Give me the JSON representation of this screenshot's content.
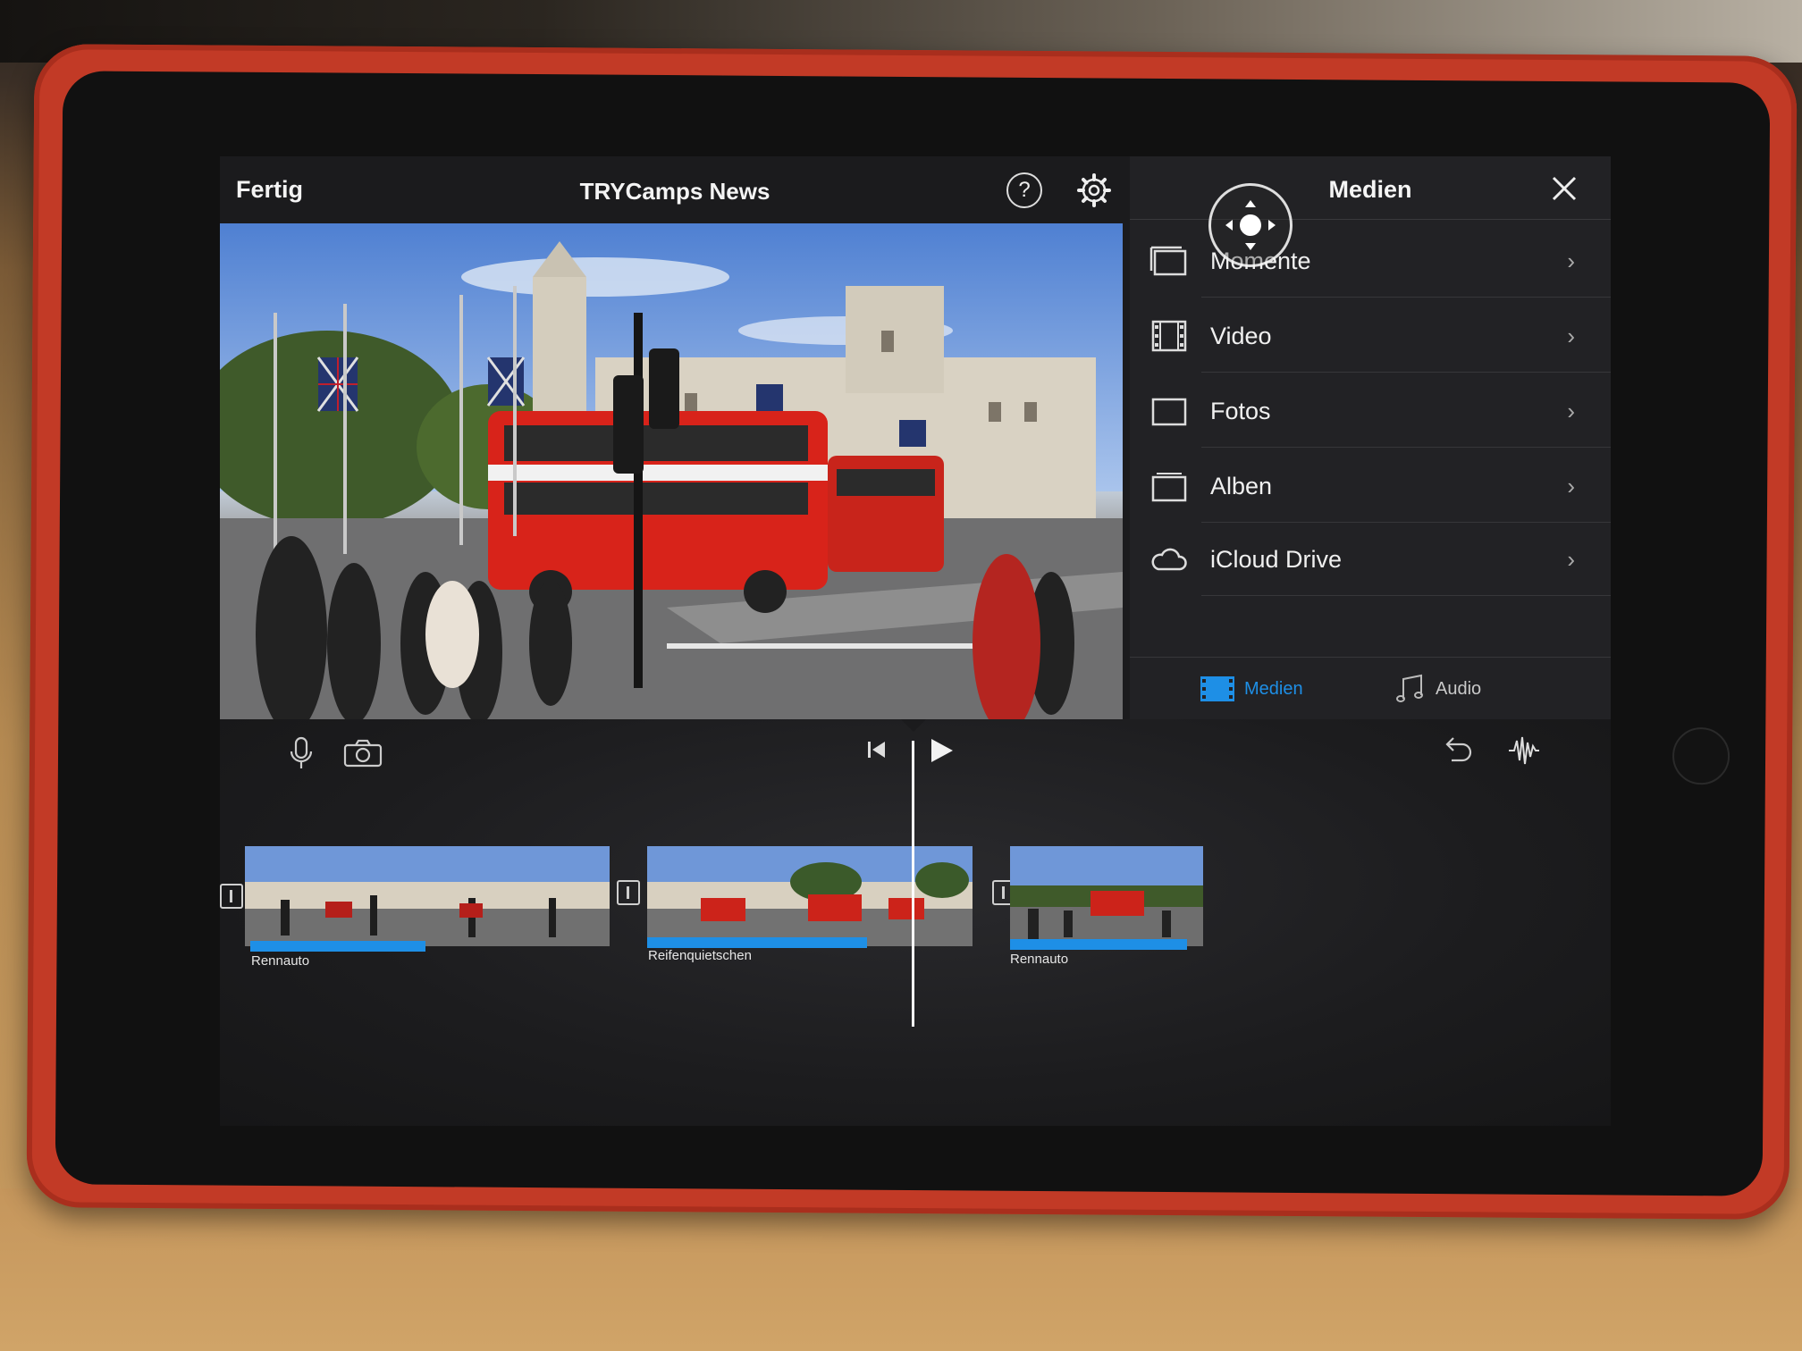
{
  "app": {
    "done_label": "Fertig",
    "project_title": "TRYCamps News",
    "help_glyph": "?"
  },
  "media_panel": {
    "title": "Medien",
    "items": [
      {
        "label": "Momente",
        "icon": "moments-icon"
      },
      {
        "label": "Video",
        "icon": "film-icon"
      },
      {
        "label": "Fotos",
        "icon": "photo-icon"
      },
      {
        "label": "Alben",
        "icon": "album-icon"
      },
      {
        "label": "iCloud Drive",
        "icon": "cloud-icon"
      }
    ],
    "chevron": "›",
    "tabs": {
      "media": {
        "label": "Medien",
        "active": true
      },
      "audio": {
        "label": "Audio",
        "active": false
      }
    }
  },
  "timeline": {
    "clips": [
      {
        "label": "Rennauto"
      },
      {
        "label": "Reifenquietschen"
      },
      {
        "label": "Rennauto"
      }
    ]
  },
  "colors": {
    "accent": "#1e8fe6",
    "panel_bg": "#222225",
    "screen_bg": "#1b1b1d",
    "case": "#c23a26"
  }
}
